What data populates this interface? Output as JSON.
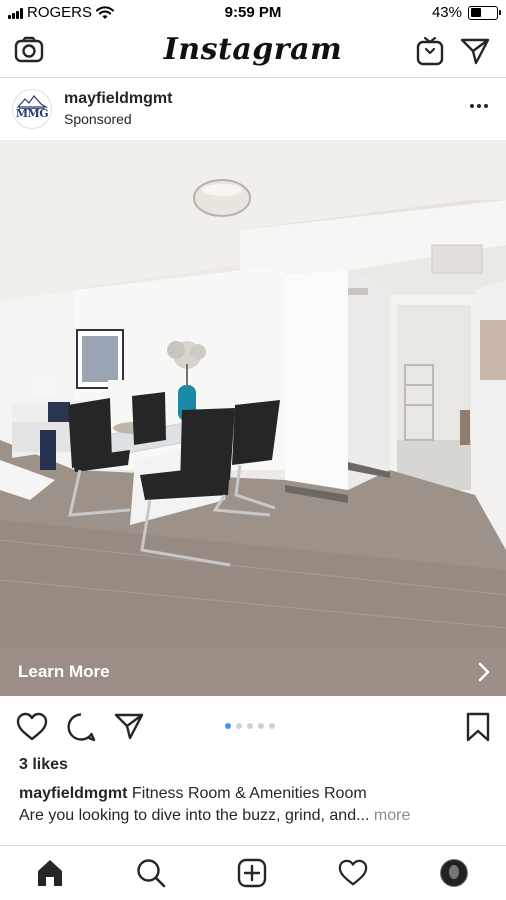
{
  "status_bar": {
    "carrier": "ROGERS",
    "time": "9:59 PM",
    "battery_text": "43%",
    "battery_level": 0.43
  },
  "top_nav": {
    "logo": "Instagram",
    "icons": [
      "camera-icon",
      "igtv-icon",
      "direct-message-icon"
    ]
  },
  "post": {
    "username": "mayfieldmgmt",
    "subtitle": "Sponsored",
    "avatar_logo_text": "MMG",
    "cta_label": "Learn More",
    "carousel": {
      "count": 5,
      "active_index": 0
    },
    "likes": "3 likes",
    "caption_username": "mayfieldmgmt",
    "caption_title": "Fitness Room & Amenities Room",
    "caption_body": "Are you looking to dive into the buzz, grind, and...",
    "caption_more": "more"
  },
  "tab_bar": {
    "icons": [
      "home-icon",
      "search-icon",
      "new-post-icon",
      "activity-heart-icon",
      "profile-avatar"
    ]
  },
  "colors": {
    "cta_background": "#9c8e86",
    "carousel_active": "#3897f0",
    "text_primary": "#262626",
    "text_muted": "#8e8e8e"
  }
}
